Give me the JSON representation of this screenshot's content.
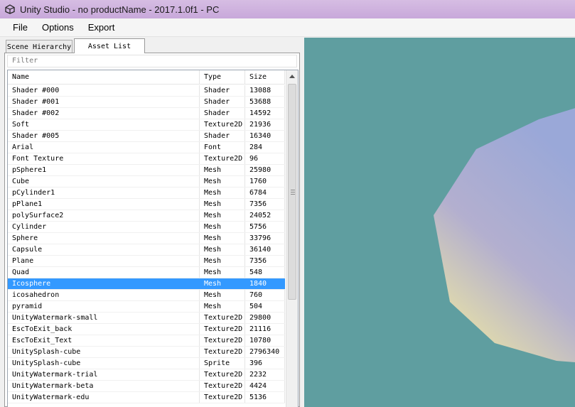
{
  "window": {
    "title": "Unity Studio - no productName - 2017.1.0f1 - PC"
  },
  "menu": [
    "File",
    "Options",
    "Export"
  ],
  "tabs": [
    "Scene Hierarchy",
    "Asset List"
  ],
  "filter": {
    "placeholder": "Filter"
  },
  "columns": [
    "Name",
    "Type",
    "Size"
  ],
  "rows": [
    [
      "Shader #000",
      "Shader",
      "13088"
    ],
    [
      "Shader #001",
      "Shader",
      "53688"
    ],
    [
      "Shader #002",
      "Shader",
      "14592"
    ],
    [
      "Soft",
      "Texture2D",
      "21936"
    ],
    [
      "Shader #005",
      "Shader",
      "16340"
    ],
    [
      "Arial",
      "Font",
      "284"
    ],
    [
      "Font Texture",
      "Texture2D",
      "96"
    ],
    [
      "pSphere1",
      "Mesh",
      "25980"
    ],
    [
      "Cube",
      "Mesh",
      "1760"
    ],
    [
      "pCylinder1",
      "Mesh",
      "6784"
    ],
    [
      "pPlane1",
      "Mesh",
      "7356"
    ],
    [
      "polySurface2",
      "Mesh",
      "24052"
    ],
    [
      "Cylinder",
      "Mesh",
      "5756"
    ],
    [
      "Sphere",
      "Mesh",
      "33796"
    ],
    [
      "Capsule",
      "Mesh",
      "36140"
    ],
    [
      "Plane",
      "Mesh",
      "7356"
    ],
    [
      "Quad",
      "Mesh",
      "548"
    ],
    [
      "Icosphere",
      "Mesh",
      "1840"
    ],
    [
      "icosahedron",
      "Mesh",
      "760"
    ],
    [
      "pyramid",
      "Mesh",
      "504"
    ],
    [
      "UnityWatermark-small",
      "Texture2D",
      "29800"
    ],
    [
      "EscToExit_back",
      "Texture2D",
      "21116"
    ],
    [
      "EscToExit_Text",
      "Texture2D",
      "10780"
    ],
    [
      "UnitySplash-cube",
      "Texture2D",
      "2796340"
    ],
    [
      "UnitySplash-cube",
      "Sprite",
      "396"
    ],
    [
      "UnityWatermark-trial",
      "Texture2D",
      "2232"
    ],
    [
      "UnityWatermark-beta",
      "Texture2D",
      "4424"
    ],
    [
      "UnityWatermark-edu",
      "Texture2D",
      "5136"
    ]
  ],
  "selected_row": 17,
  "colors": {
    "selection": "#3399ff",
    "viewport_bg": "#5f9ea0",
    "titlebar": "#c8a8da"
  }
}
